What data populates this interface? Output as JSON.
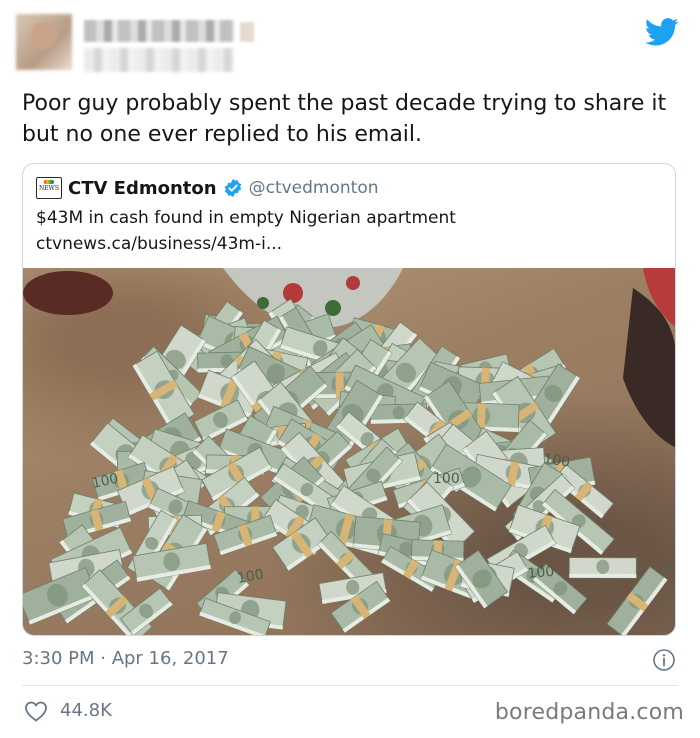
{
  "tweet": {
    "text": "Poor guy probably spent the past decade trying to share it but no one ever replied to his email.",
    "timestamp": "3:30 PM · Apr 16, 2017",
    "likes": "44.8K"
  },
  "quoted": {
    "logo_text": "NEWS",
    "name": "CTV Edmonton",
    "handle": "@ctvedmonton",
    "title": "$43M in cash found in empty Nigerian apartment",
    "link": "ctvnews.ca/business/43m-i..."
  },
  "photo": {
    "bill_label": "100"
  },
  "watermark": "boredpanda.com",
  "icons": {
    "brand": "twitter-bird-icon",
    "verified": "verified-badge-icon",
    "info": "info-icon",
    "like": "heart-icon"
  },
  "colors": {
    "twitter_blue": "#1da1f2",
    "text": "#14171a",
    "muted": "#657786",
    "border": "#ccd6dd",
    "money_green": "#b5c4b0"
  }
}
